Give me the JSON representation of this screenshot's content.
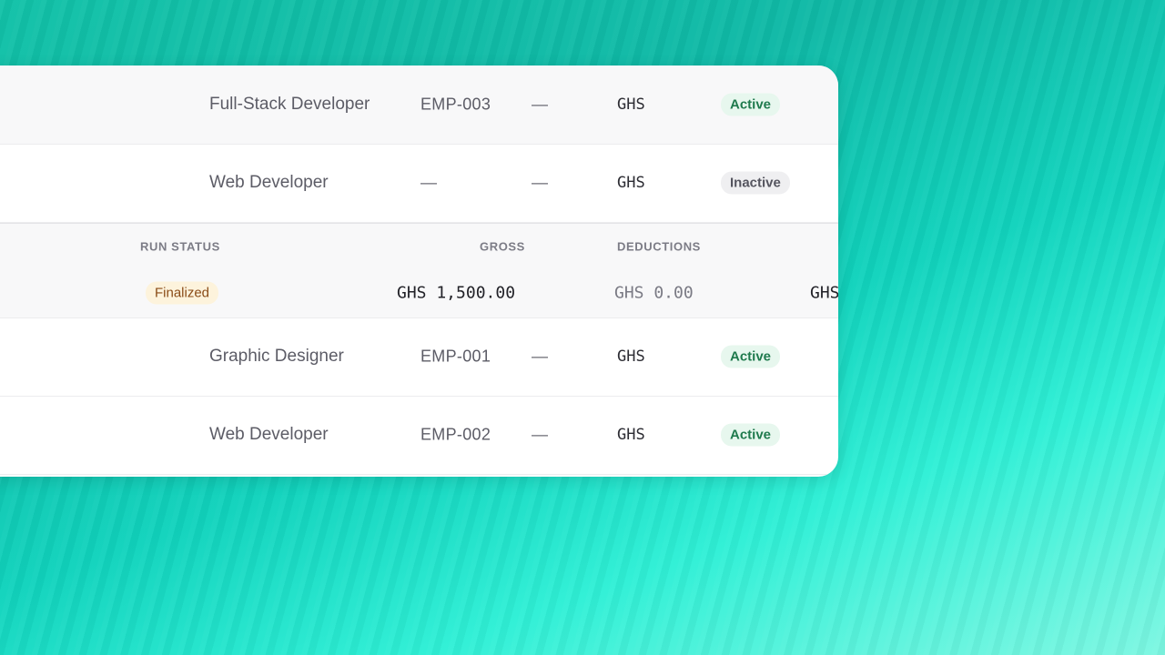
{
  "employees_top": [
    {
      "role": "Full-Stack Developer",
      "code": "EMP-003",
      "extra": "—",
      "currency": "GHS",
      "status": "Active"
    },
    {
      "role": "Web Developer",
      "code": "—",
      "extra": "—",
      "currency": "GHS",
      "status": "Inactive"
    }
  ],
  "payroll": {
    "headers": {
      "run_status": "RUN STATUS",
      "gross": "GROSS",
      "deductions": "DEDUCTIONS"
    },
    "row": {
      "status": "Finalized",
      "gross": "GHS 1,500.00",
      "deductions": "GHS 0.00",
      "net_partial": "GHS"
    }
  },
  "employees_bottom": [
    {
      "role": "Graphic Designer",
      "code": "EMP-001",
      "extra": "—",
      "currency": "GHS",
      "status": "Active"
    },
    {
      "role": "Web Developer",
      "code": "EMP-002",
      "extra": "—",
      "currency": "GHS",
      "status": "Active"
    }
  ],
  "colors": {
    "active_bg": "#e7f7ee",
    "active_text": "#1f7a4d",
    "finalized_bg": "#fdf3dc",
    "finalized_text": "#8a4b16"
  }
}
